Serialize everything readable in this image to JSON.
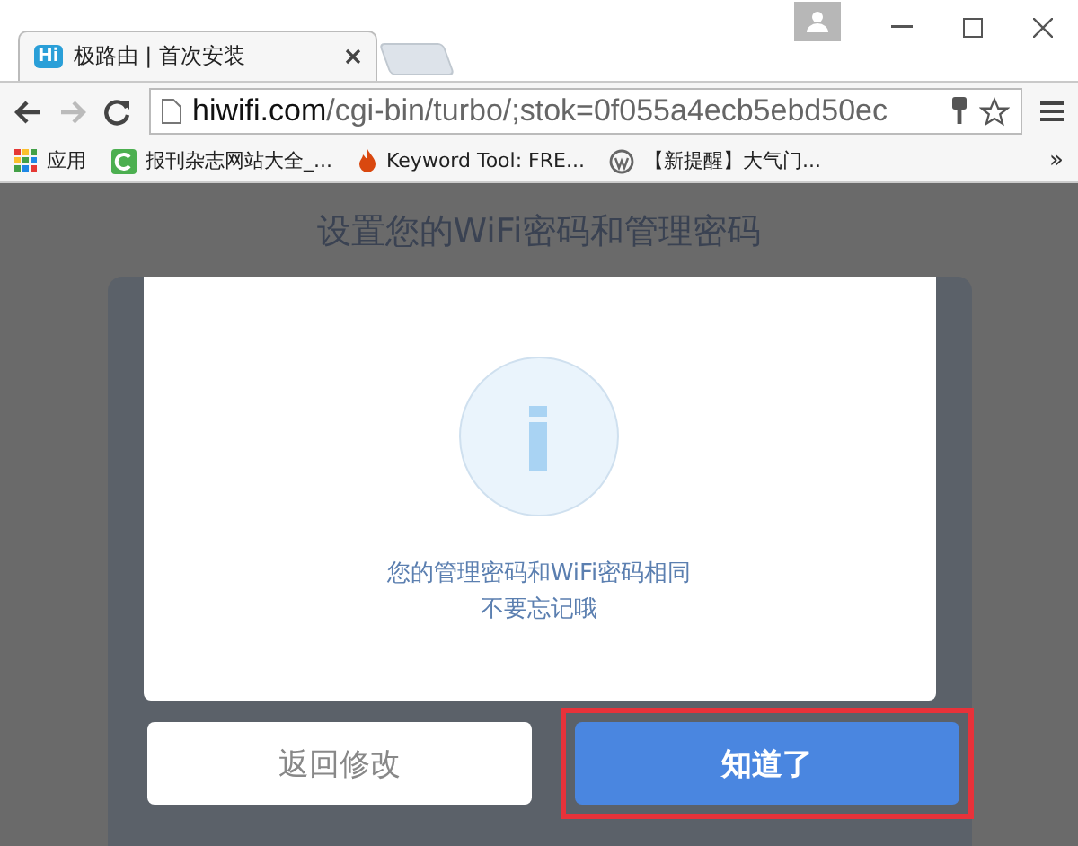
{
  "browser": {
    "tab": {
      "favicon": "Hi",
      "title": "极路由 | 首次安装"
    },
    "address": {
      "domain": "hiwifi.com",
      "path": "/cgi-bin/turbo/;stok=0f055a4ecb5ebd50ec"
    },
    "bookmarks": [
      {
        "kind": "apps",
        "label": "应用"
      },
      {
        "kind": "letter",
        "label": "报刊杂志网站大全_..."
      },
      {
        "kind": "flame",
        "label": "Keyword Tool: FRE..."
      },
      {
        "kind": "wordpress",
        "label": "【新提醒】大气门..."
      }
    ],
    "more": "»"
  },
  "page": {
    "heading": "设置您的WiFi密码和管理密码",
    "dialog": {
      "message": [
        "您的管理密码和WiFi密码相同",
        "不要忘记哦"
      ]
    },
    "buttons": [
      {
        "kind": "secondary",
        "label": "返回修改",
        "highlighted": false
      },
      {
        "kind": "primary",
        "label": "知道了",
        "highlighted": true
      }
    ]
  }
}
